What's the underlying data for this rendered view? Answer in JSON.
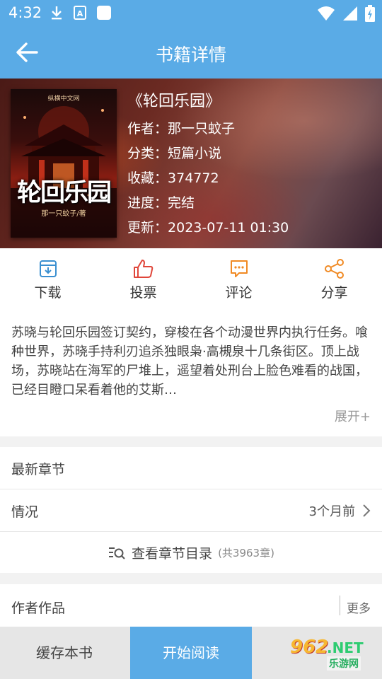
{
  "status_bar": {
    "time": "4:32"
  },
  "nav": {
    "title": "书籍详情"
  },
  "book": {
    "title": "《轮回乐园》",
    "author_label": "作者：",
    "author": "那一只蚊子",
    "category_label": "分类：",
    "category": "短篇小说",
    "favorites_label": "收藏：",
    "favorites": "374772",
    "progress_label": "进度：",
    "progress": "完结",
    "updated_label": "更新：",
    "updated": "2023-07-11 01:30",
    "cover": {
      "publisher": "纵横中文网",
      "title": "轮回乐园",
      "author_line": "那一只蚊子/著"
    }
  },
  "actions": [
    {
      "label": "下载",
      "icon": "download-box-icon",
      "color": "#3a8fd0"
    },
    {
      "label": "投票",
      "icon": "thumbs-up-icon",
      "color": "#e0463a"
    },
    {
      "label": "评论",
      "icon": "comment-icon",
      "color": "#f08a24"
    },
    {
      "label": "分享",
      "icon": "share-icon",
      "color": "#f08a24"
    }
  ],
  "description": {
    "text": "苏晓与轮回乐园签订契约，穿梭在各个动漫世界内执行任务。喰种世界，苏晓手持利刃追杀独眼枭·高槻泉十几条街区。顶上战场，苏晓站在海军的尸堆上，遥望着处刑台上脸色难看的战国，已经目瞪口呆看着他的艾斯…",
    "expand": "展开+"
  },
  "chapters": {
    "latest_label": "最新章节",
    "status_label": "情况",
    "status_value": "3个月前",
    "catalog_text": "查看章节目录",
    "catalog_count": "(共3963章)"
  },
  "works": {
    "label": "作者作品",
    "more": "更多"
  },
  "bottom": {
    "cache": "缓存本书",
    "read": "开始阅读",
    "watermark_num": "962",
    "watermark_net": ".NET",
    "watermark_site": "乐游网"
  },
  "colors": {
    "primary": "#5aabe6",
    "red": "#e0463a",
    "orange": "#f08a24",
    "blue": "#3a8fd0"
  }
}
